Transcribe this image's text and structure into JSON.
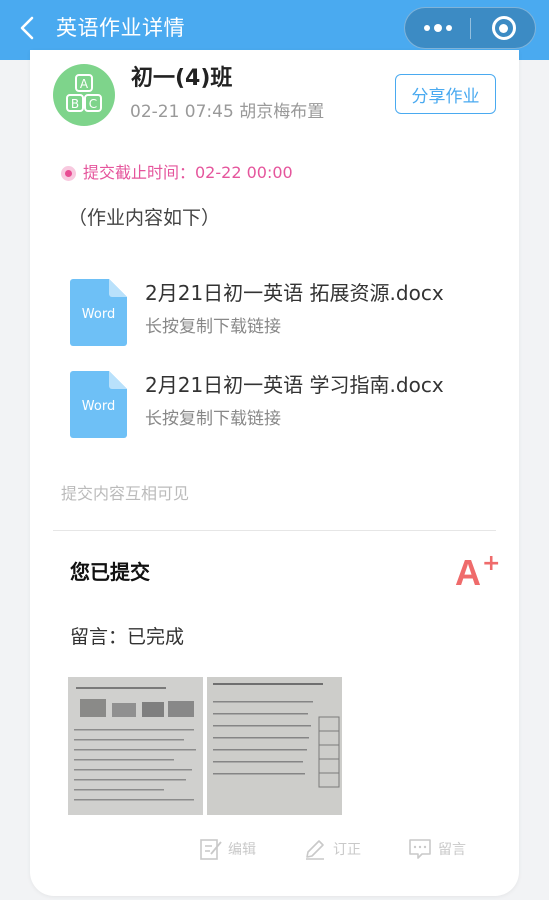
{
  "navbar": {
    "title": "英语作业详情"
  },
  "assignment": {
    "avatar_letters": [
      "A",
      "B",
      "C"
    ],
    "class_name": "初一(4)班",
    "meta": "02-21 07:45 胡京梅布置",
    "share_label": "分享作业",
    "deadline": "提交截止时间：02-22 00:00",
    "content_note": "（作业内容如下）",
    "files": [
      {
        "icon_label": "Word",
        "name": "2月21日初一英语 拓展资源.docx",
        "hint": "长按复制下载链接"
      },
      {
        "icon_label": "Word",
        "name": "2月21日初一英语 学习指南.docx",
        "hint": "长按复制下载链接"
      }
    ],
    "visibility": "提交内容互相可见"
  },
  "submission": {
    "title": "您已提交",
    "grade": "A",
    "grade_suffix": "+",
    "comment": "留言：已完成",
    "photos": [
      "worksheet-photo-1",
      "worksheet-photo-2"
    ],
    "actions": {
      "edit": "编辑",
      "correct": "订正",
      "comment": "留言"
    }
  },
  "colors": {
    "brand": "#4aaaf0",
    "deadline": "#e5559c",
    "grade": "#ef6b6b",
    "avatar": "#7ed48b"
  }
}
